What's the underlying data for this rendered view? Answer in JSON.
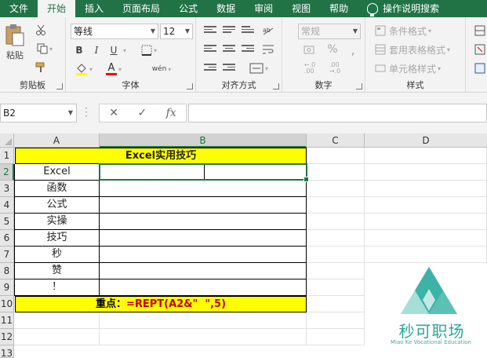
{
  "tabs": [
    "文件",
    "开始",
    "插入",
    "页面布局",
    "公式",
    "数据",
    "审阅",
    "视图",
    "帮助"
  ],
  "active_tab": "开始",
  "tell_me": "操作说明搜索",
  "ribbon": {
    "clipboard": {
      "paste": "粘贴",
      "label": "剪贴板"
    },
    "font": {
      "name": "等线",
      "size": "12",
      "bold": "B",
      "italic": "I",
      "underline": "U",
      "font_color_glyph": "A",
      "phonetic": "wén",
      "label": "字体"
    },
    "alignment": {
      "label": "对齐方式"
    },
    "number": {
      "format": "常规",
      "percent": "%",
      "comma": ",",
      "label": "数字"
    },
    "styles": {
      "conditional": "条件格式",
      "table": "套用表格格式",
      "cell": "单元格样式",
      "label": "样式"
    }
  },
  "formula_bar": {
    "name_box": "B2",
    "cancel": "✕",
    "enter": "✓",
    "fx": "fx",
    "value": ""
  },
  "columns": [
    "A",
    "B",
    "C",
    "D"
  ],
  "rows": [
    "1",
    "2",
    "3",
    "4",
    "5",
    "6",
    "7",
    "8",
    "9",
    "10",
    "11",
    "12",
    "13"
  ],
  "selected_cell": "B2",
  "sheet": {
    "title": "Excel实用技巧",
    "a_values": [
      "Excel",
      "函数",
      "公式",
      "实操",
      "技巧",
      "秒",
      "赞",
      "！"
    ],
    "tip_label": "重点：",
    "tip_formula": "=REPT(A2&\"  \",5)"
  },
  "watermark": {
    "name": "秒可职场",
    "sub": "Miao Ke Vocational Education"
  },
  "colors": {
    "excel_green": "#217346",
    "highlight": "#ffff00",
    "formula_red": "#c00000",
    "watermark": "#2aa59a"
  }
}
